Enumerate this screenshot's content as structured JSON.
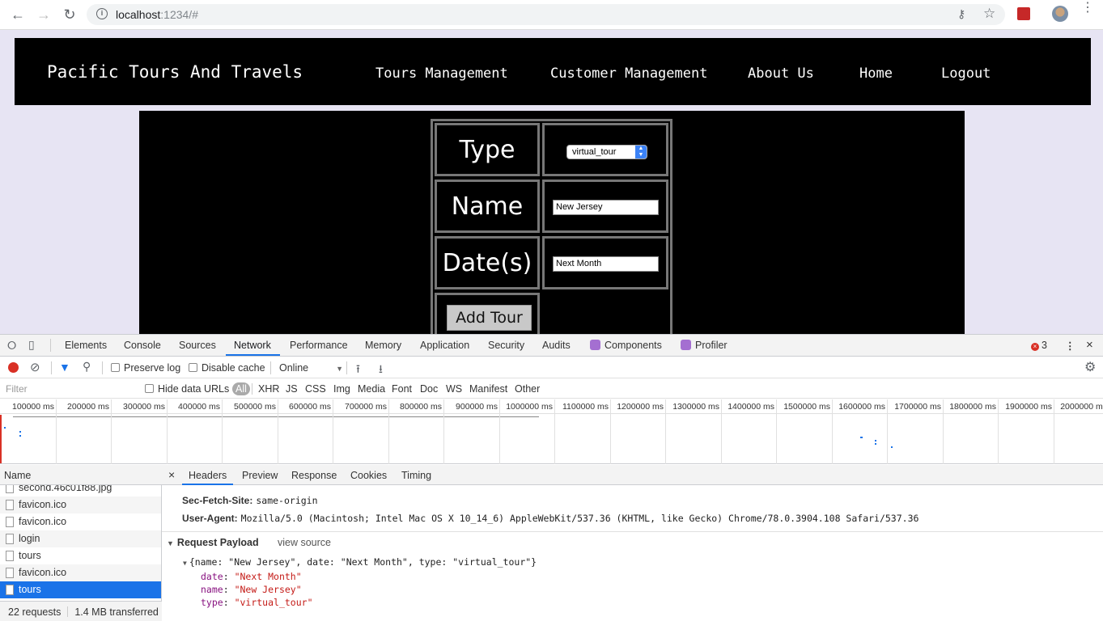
{
  "browser": {
    "url_host": "localhost",
    "url_rest": ":1234/#"
  },
  "site": {
    "brand": "Pacific Tours And Travels",
    "nav": [
      "Tours Management",
      "Customer Management",
      "About Us",
      "Home",
      "Logout"
    ],
    "form": {
      "type_label": "Type",
      "type_value": "virtual_tour",
      "name_label": "Name",
      "name_value": "New Jersey",
      "dates_label": "Date(s)",
      "dates_value": "Next Month",
      "submit_label": "Add Tour"
    }
  },
  "devtools": {
    "tabs": [
      "Elements",
      "Console",
      "Sources",
      "Network",
      "Performance",
      "Memory",
      "Application",
      "Security",
      "Audits",
      "Components",
      "Profiler"
    ],
    "active_tab": "Network",
    "error_count": "3",
    "toolbar": {
      "preserve_log": "Preserve log",
      "disable_cache": "Disable cache",
      "throttle": "Online"
    },
    "filter": {
      "placeholder": "Filter",
      "hide_data_urls": "Hide data URLs",
      "types": [
        "All",
        "XHR",
        "JS",
        "CSS",
        "Img",
        "Media",
        "Font",
        "Doc",
        "WS",
        "Manifest",
        "Other"
      ]
    },
    "timeline_ticks": [
      "100000 ms",
      "200000 ms",
      "300000 ms",
      "400000 ms",
      "500000 ms",
      "600000 ms",
      "700000 ms",
      "800000 ms",
      "900000 ms",
      "1000000 ms",
      "1100000 ms",
      "1200000 ms",
      "1300000 ms",
      "1400000 ms",
      "1500000 ms",
      "1600000 ms",
      "1700000 ms",
      "1800000 ms",
      "1900000 ms",
      "2000000 ms"
    ],
    "name_header": "Name",
    "requests": [
      "second.46c01f88.jpg",
      "favicon.ico",
      "favicon.ico",
      "login",
      "tours",
      "favicon.ico",
      "tours"
    ],
    "summary": {
      "requests": "22 requests",
      "transferred": "1.4 MB transferred"
    },
    "detail_tabs": [
      "Headers",
      "Preview",
      "Response",
      "Cookies",
      "Timing"
    ],
    "headers": {
      "sec_fetch_site_key": "Sec-Fetch-Site:",
      "sec_fetch_site_val": "same-origin",
      "user_agent_key": "User-Agent:",
      "user_agent_val": "Mozilla/5.0 (Macintosh; Intel Mac OS X 10_14_6) AppleWebKit/537.36 (KHTML, like Gecko) Chrome/78.0.3904.108 Safari/537.36"
    },
    "payload": {
      "title": "Request Payload",
      "view_source": "view source",
      "summary": "{name: \"New Jersey\", date: \"Next Month\", type: \"virtual_tour\"}",
      "date_key": "date",
      "date_val": "\"Next Month\"",
      "name_key": "name",
      "name_val": "\"New Jersey\"",
      "type_key": "type",
      "type_val": "\"virtual_tour\""
    }
  }
}
